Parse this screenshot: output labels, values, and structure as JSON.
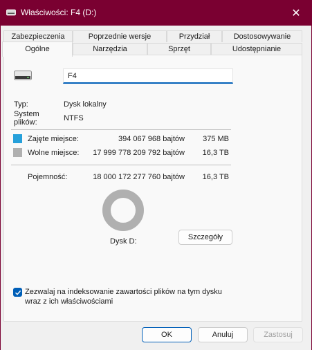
{
  "window": {
    "title": "Właściwości: F4 (D:)",
    "close_glyph": "✕"
  },
  "tabs_row1": [
    {
      "label": "Zabezpieczenia"
    },
    {
      "label": "Poprzednie wersje"
    },
    {
      "label": "Przydział"
    },
    {
      "label": "Dostosowywanie"
    }
  ],
  "tabs_row2": [
    {
      "label": "Ogólne",
      "active": true
    },
    {
      "label": "Narzędzia"
    },
    {
      "label": "Sprzęt"
    },
    {
      "label": "Udostępnianie"
    }
  ],
  "general": {
    "drive_name": "F4",
    "type_label": "Typ:",
    "type_value": "Dysk lokalny",
    "fs_label_line1": "System",
    "fs_label_line2": "plików:",
    "fs_value": "NTFS",
    "used_label": "Zajęte miejsce:",
    "used_bytes": "394 067 968 bajtów",
    "used_short": "375 MB",
    "free_label": "Wolne miejsce:",
    "free_bytes": "17 999 778 209 792 bajtów",
    "free_short": "16,3 TB",
    "capacity_label": "Pojemność:",
    "capacity_bytes": "18 000 172 277 760 bajtów",
    "capacity_short": "16,3 TB",
    "disk_label": "Dysk D:",
    "details_button": "Szczegóły",
    "index_line1": "Zezwalaj na indeksowanie zawartości plików na tym dysku",
    "index_line2": "wraz z ich właściwościami",
    "index_checked": true,
    "used_fraction": 2.19e-05
  },
  "colors": {
    "used": "#26a0da",
    "free": "#b0b0b0",
    "titlebar": "#7a0031",
    "accent": "#005fb8"
  },
  "footer": {
    "ok": "OK",
    "cancel": "Anuluj",
    "apply": "Zastosuj"
  }
}
